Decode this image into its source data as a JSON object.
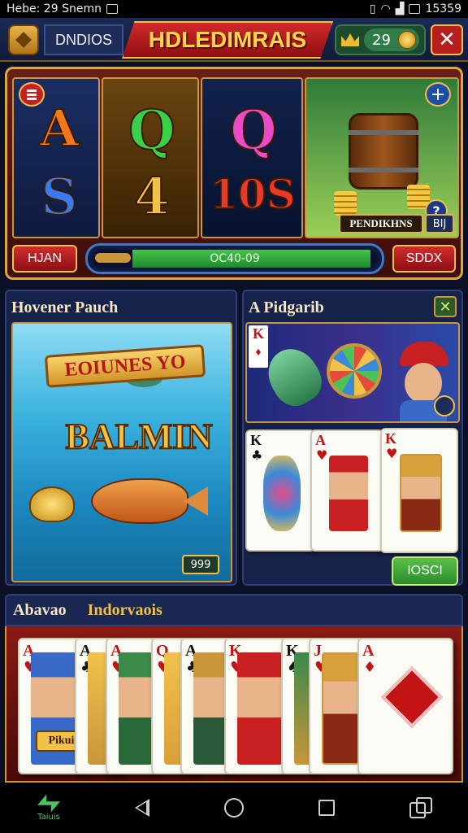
{
  "status_bar": {
    "left_text": "Hebe: 29 Snemn",
    "right_text": "15359"
  },
  "header": {
    "left_label": "DNDIOS",
    "title": "HDLEDIMRAIS",
    "coins": "29"
  },
  "slot": {
    "reel_symbols": [
      {
        "top": "A",
        "bottom": "S"
      },
      {
        "top": "Q",
        "bottom": "4"
      },
      {
        "top": "Q",
        "bottom": "10S"
      }
    ],
    "reel4_label": "PENDIKHNS",
    "reel4_badge": "BIJ",
    "left_button": "HJAN",
    "right_button": "SDDX",
    "progress_text": "OC40-09",
    "progress_fraction": 0.97
  },
  "left_panel": {
    "title": "Hovener Pauch",
    "banner": "EOIUNES YO",
    "word": "BALMIN",
    "badge": "999"
  },
  "right_panel": {
    "title": "A Pidgarib",
    "cards": [
      {
        "rank": "K",
        "suit": "♣",
        "color": "black"
      },
      {
        "rank": "A",
        "suit": "♥",
        "color": "red"
      },
      {
        "rank": "K",
        "suit": "♥",
        "color": "red"
      }
    ],
    "button": "IOSCI"
  },
  "tabs": [
    {
      "label": "Abavao"
    },
    {
      "label": "Indorvaois"
    }
  ],
  "hand": {
    "cards": [
      {
        "rank": "A",
        "suit": "♥",
        "color": "red",
        "label": "Pikuinis"
      },
      {
        "rank": "A",
        "suit": "♣",
        "color": "black"
      },
      {
        "rank": "A",
        "suit": "♥",
        "color": "red"
      },
      {
        "rank": "Q",
        "suit": "♥",
        "color": "red"
      },
      {
        "rank": "A",
        "suit": "♣",
        "color": "black"
      },
      {
        "rank": "K",
        "suit": "♥",
        "color": "red"
      },
      {
        "rank": "K",
        "suit": "♠",
        "color": "black"
      },
      {
        "rank": "J",
        "suit": "♥",
        "color": "red"
      },
      {
        "rank": "A",
        "suit": "♦",
        "color": "red"
      }
    ]
  },
  "nav": {
    "app_label": "Taiuis"
  }
}
